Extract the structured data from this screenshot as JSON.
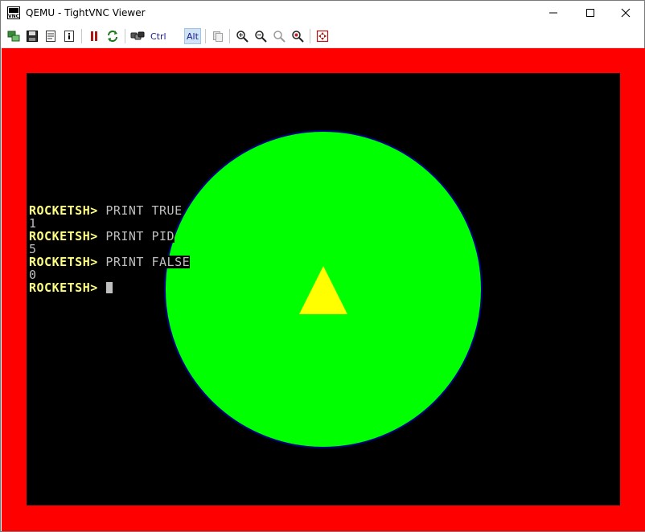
{
  "window": {
    "title": "QEMU - TightVNC Viewer",
    "icon": "vnc-app-icon"
  },
  "toolbar": {
    "ctrl_label": "Ctrl",
    "alt_label": "Alt",
    "buttons": [
      "new-connection-icon",
      "save-icon",
      "options-icon",
      "info-icon",
      "pause-icon",
      "refresh-icon",
      "ctrl-alt-del-icon",
      "ctrl-label",
      "alt-label",
      "clipboard-icon",
      "zoom-in-icon",
      "zoom-out-icon",
      "zoom-100-icon",
      "zoom-auto-icon",
      "fullscreen-icon"
    ]
  },
  "colors": {
    "border": "#ff0000",
    "screen": "#000000",
    "circle_fill": "#00ff00",
    "circle_stroke": "#000080",
    "triangle": "#ffff00",
    "prompt": "#ffff80",
    "text": "#bfbfbf"
  },
  "terminal": {
    "lines": [
      {
        "prompt": "ROCKETSH> ",
        "text": "PRINT TRUE"
      },
      {
        "prompt": "",
        "text": "1"
      },
      {
        "prompt": "ROCKETSH> ",
        "text": "PRINT PID"
      },
      {
        "prompt": "",
        "text": "5"
      },
      {
        "prompt": "ROCKETSH> ",
        "text": "PRINT FALSE"
      },
      {
        "prompt": "",
        "text": "0"
      },
      {
        "prompt": "ROCKETSH> ",
        "text": ""
      }
    ]
  }
}
